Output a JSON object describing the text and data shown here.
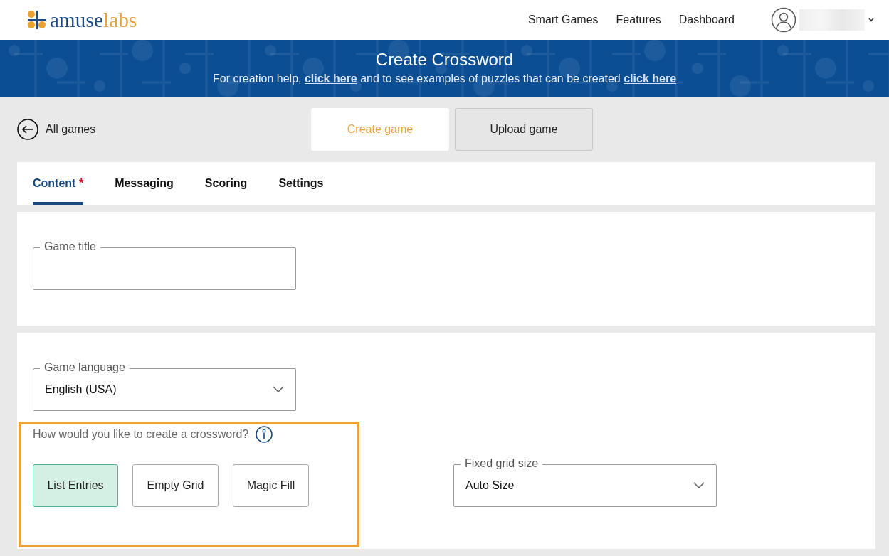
{
  "header": {
    "logo": {
      "first": "amuse",
      "second": "labs"
    },
    "nav": [
      "Smart Games",
      "Features",
      "Dashboard"
    ]
  },
  "banner": {
    "title": "Create Crossword",
    "help": {
      "before": "For creation help, ",
      "link1": "click here",
      "middle": " and to see examples of puzzles that can be created ",
      "link2": "click here"
    }
  },
  "back_link": "All games",
  "mode_tabs": [
    {
      "label": "Create game",
      "selected": true
    },
    {
      "label": "Upload game",
      "selected": false
    }
  ],
  "tabs": [
    {
      "label": "Content",
      "selected": true,
      "marker": "*"
    },
    {
      "label": "Messaging",
      "selected": false
    },
    {
      "label": "Scoring",
      "selected": false
    },
    {
      "label": "Settings",
      "selected": false
    }
  ],
  "game_title": {
    "label": "Game title"
  },
  "game_language": {
    "label": "Game language",
    "value": "English (USA)"
  },
  "creation": {
    "question": "How would you like to create a crossword?",
    "options": [
      {
        "label": "List Entries",
        "selected": true
      },
      {
        "label": "Empty Grid",
        "selected": false
      },
      {
        "label": "Magic Fill",
        "selected": false
      }
    ]
  },
  "grid_size": {
    "label": "Fixed grid size",
    "value": "Auto Size"
  }
}
